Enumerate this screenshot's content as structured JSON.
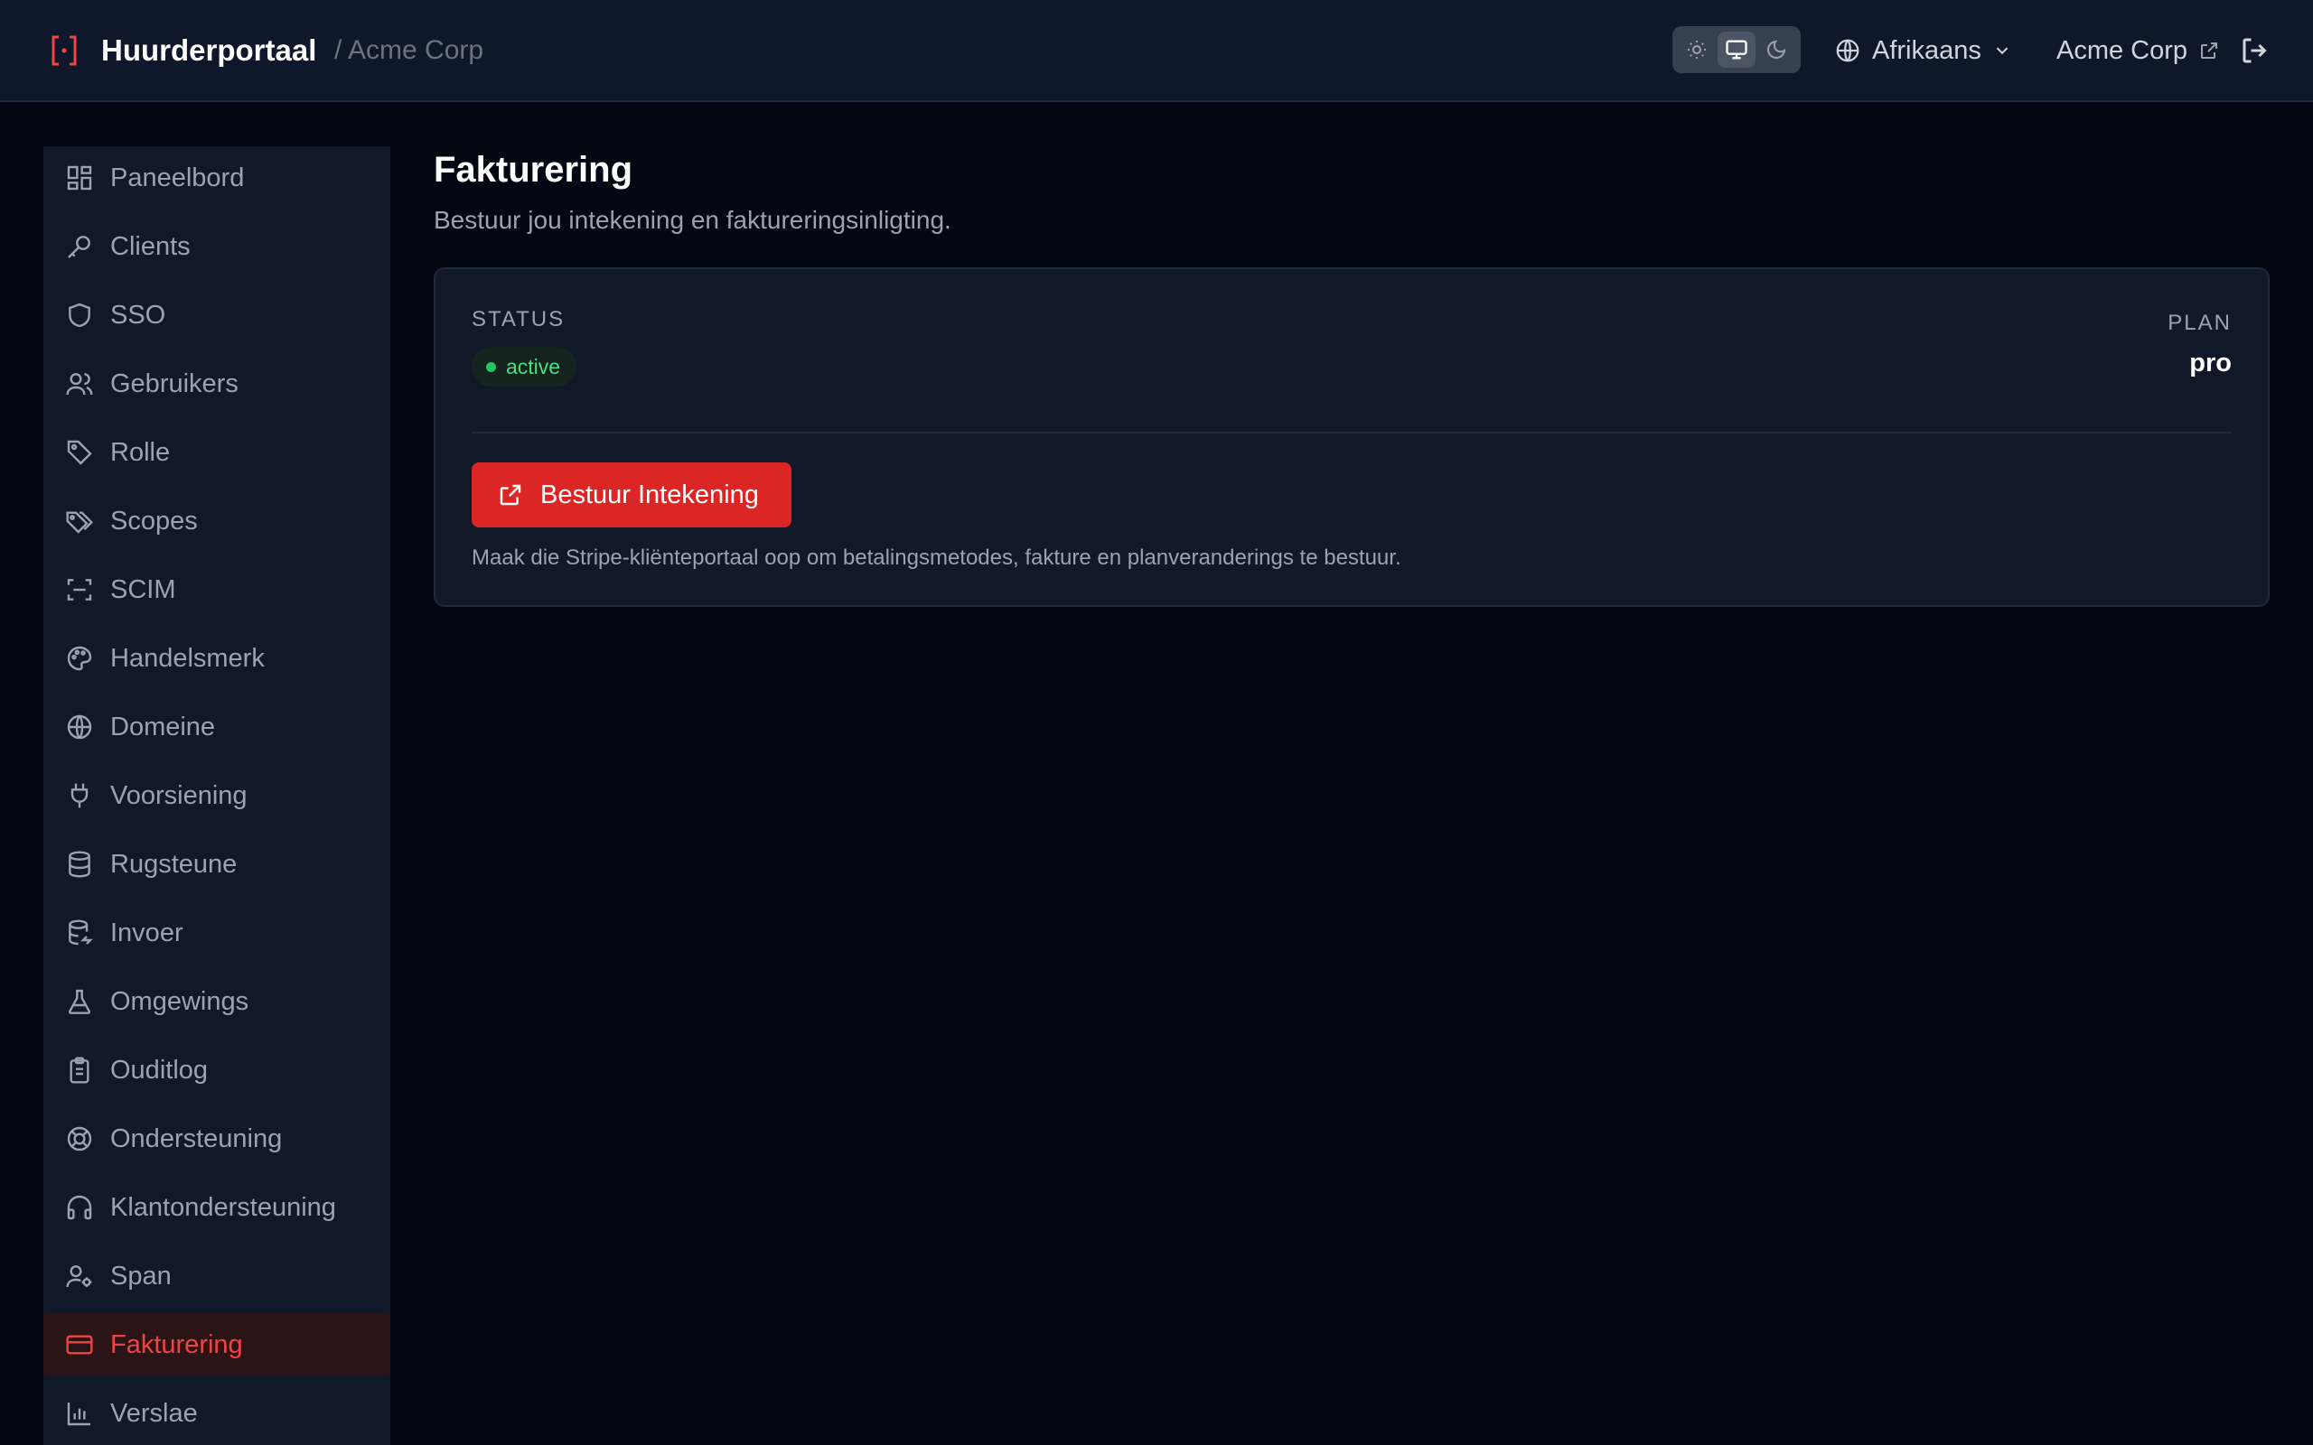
{
  "header": {
    "brand_title": "Huurderportaal",
    "tenant_breadcrumb": "/ Acme Corp",
    "theme_options": [
      "light",
      "system",
      "dark"
    ],
    "theme_selected": "system",
    "language": "Afrikaans",
    "tenant_name": "Acme Corp"
  },
  "sidebar": {
    "items": [
      {
        "label": "Paneelbord",
        "icon": "dashboard-icon"
      },
      {
        "label": "Clients",
        "icon": "key-icon"
      },
      {
        "label": "SSO",
        "icon": "shield-icon"
      },
      {
        "label": "Gebruikers",
        "icon": "users-icon"
      },
      {
        "label": "Rolle",
        "icon": "tag-icon"
      },
      {
        "label": "Scopes",
        "icon": "tags-icon"
      },
      {
        "label": "SCIM",
        "icon": "scan-icon"
      },
      {
        "label": "Handelsmerk",
        "icon": "palette-icon"
      },
      {
        "label": "Domeine",
        "icon": "globe-icon"
      },
      {
        "label": "Voorsiening",
        "icon": "plug-icon"
      },
      {
        "label": "Rugsteune",
        "icon": "database-icon"
      },
      {
        "label": "Invoer",
        "icon": "database-import-icon"
      },
      {
        "label": "Omgewings",
        "icon": "flask-icon"
      },
      {
        "label": "Ouditlog",
        "icon": "clipboard-icon"
      },
      {
        "label": "Ondersteuning",
        "icon": "lifebuoy-icon"
      },
      {
        "label": "Klantondersteuning",
        "icon": "headphones-icon"
      },
      {
        "label": "Span",
        "icon": "user-cog-icon"
      },
      {
        "label": "Fakturering",
        "icon": "credit-card-icon",
        "active": true
      },
      {
        "label": "Verslae",
        "icon": "bar-chart-icon"
      }
    ]
  },
  "main": {
    "title": "Fakturering",
    "subtitle": "Bestuur jou intekening en faktureringsinligting.",
    "status_label": "STATUS",
    "status_value": "active",
    "plan_label": "PLAN",
    "plan_value": "pro",
    "manage_button_label": "Bestuur Intekening",
    "hint": "Maak die Stripe-kliënteportaal oop om betalingsmetodes, fakture en planveranderings te bestuur."
  },
  "colors": {
    "accent": "#dc2626",
    "status_active": "#22c55e",
    "background": "#030712",
    "surface": "#111827"
  }
}
